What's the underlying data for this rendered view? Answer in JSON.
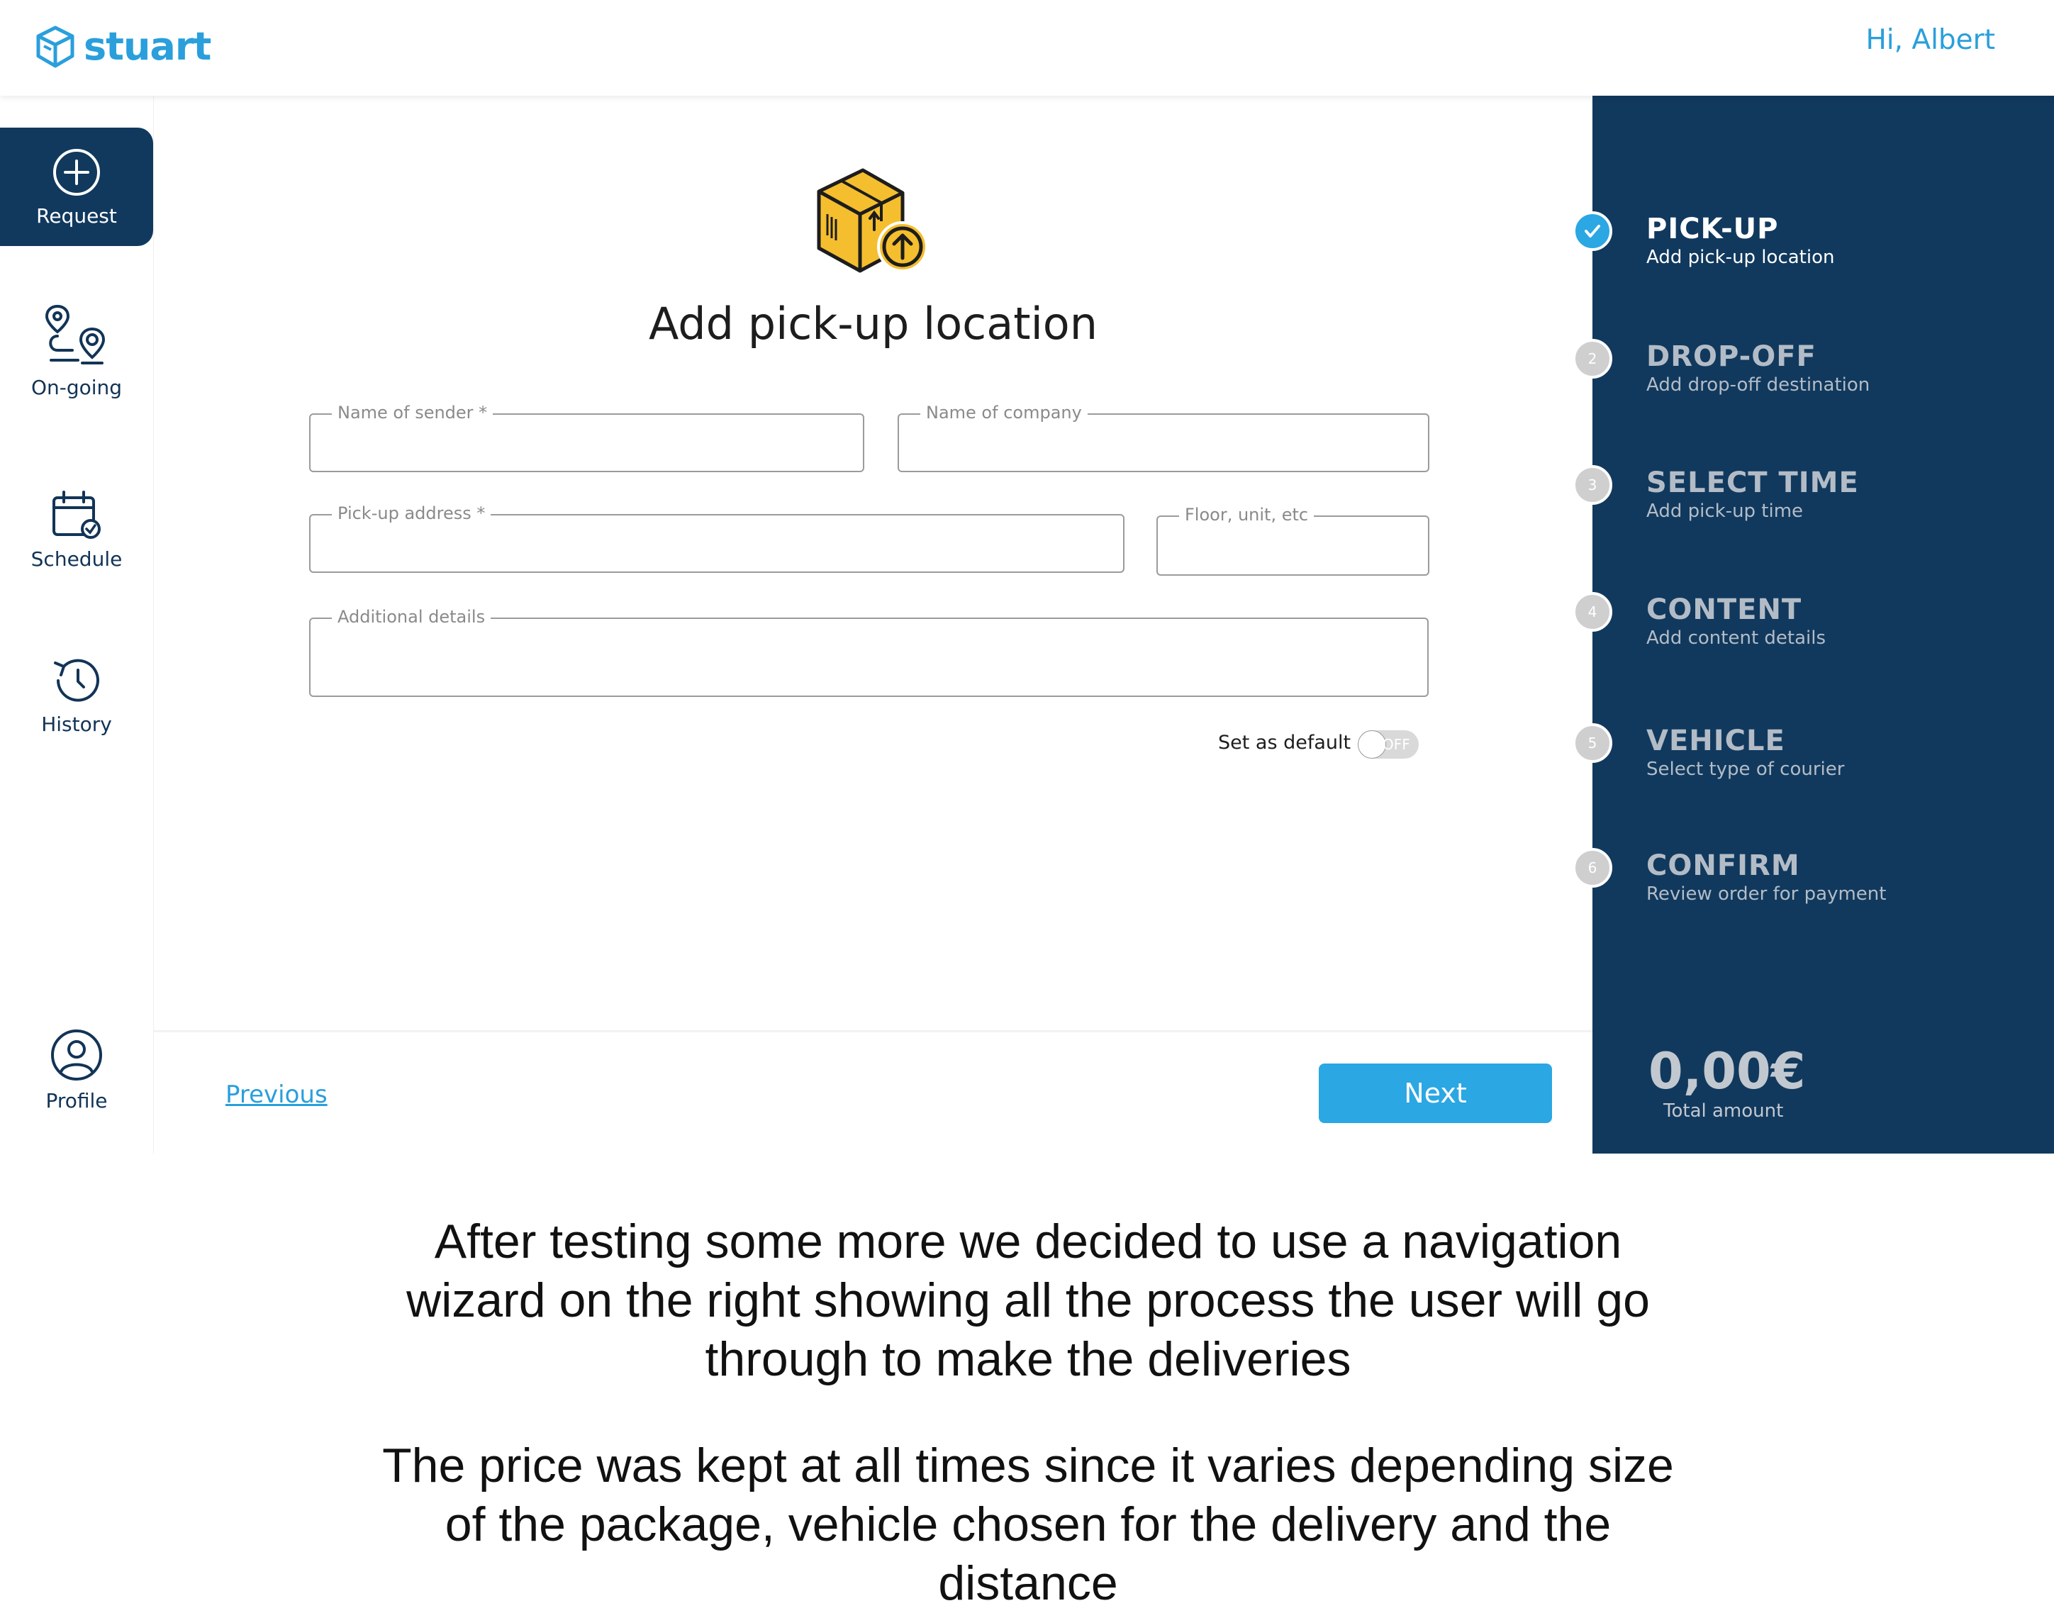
{
  "header": {
    "logo_text": "stuart",
    "greeting": "Hi, Albert",
    "brand_color": "#2a9fdc"
  },
  "sidebar": {
    "items": [
      {
        "label": "Request",
        "icon": "plus-circle-icon",
        "active": true
      },
      {
        "label": "On-going",
        "icon": "route-pin-icon",
        "active": false
      },
      {
        "label": "Schedule",
        "icon": "calendar-check-icon",
        "active": false
      },
      {
        "label": "History",
        "icon": "history-clock-icon",
        "active": false
      },
      {
        "label": "Profile",
        "icon": "user-circle-icon",
        "active": false
      }
    ]
  },
  "form": {
    "title": "Add pick-up location",
    "illustration": "package-upload-icon",
    "fields": {
      "sender": {
        "label": "Name of sender *",
        "value": ""
      },
      "company": {
        "label": "Name of company",
        "value": ""
      },
      "address": {
        "label": "Pick-up address *",
        "value": ""
      },
      "floor": {
        "label": "Floor, unit, etc",
        "value": ""
      },
      "details": {
        "label": "Additional details",
        "value": ""
      }
    },
    "default_toggle": {
      "label": "Set as default",
      "state": "OFF"
    }
  },
  "footer": {
    "previous": "Previous",
    "next": "Next"
  },
  "wizard": {
    "steps": [
      {
        "number": "✓",
        "title": "PICK-UP",
        "subtitle": "Add pick-up location",
        "status": "done"
      },
      {
        "number": "2",
        "title": "DROP-OFF",
        "subtitle": "Add drop-off destination",
        "status": "pending"
      },
      {
        "number": "3",
        "title": "SELECT TIME",
        "subtitle": "Add pick-up time",
        "status": "pending"
      },
      {
        "number": "4",
        "title": "CONTENT",
        "subtitle": "Add content details",
        "status": "pending"
      },
      {
        "number": "5",
        "title": "VEHICLE",
        "subtitle": "Select type of courier",
        "status": "pending"
      },
      {
        "number": "6",
        "title": "CONFIRM",
        "subtitle": "Review order for payment",
        "status": "pending"
      }
    ],
    "price": "0,00€",
    "price_label": "Total amount",
    "panel_color": "#11395e"
  },
  "caption": {
    "line1": "After testing some more we decided to use a navigation",
    "line2": "wizard on the right showing all the process the user will go",
    "line3": "through to make the deliveries",
    "line4": "The price was kept at all times since it varies depending size",
    "line5": "of the package, vehicle chosen for the delivery and the",
    "line6": "distance"
  }
}
